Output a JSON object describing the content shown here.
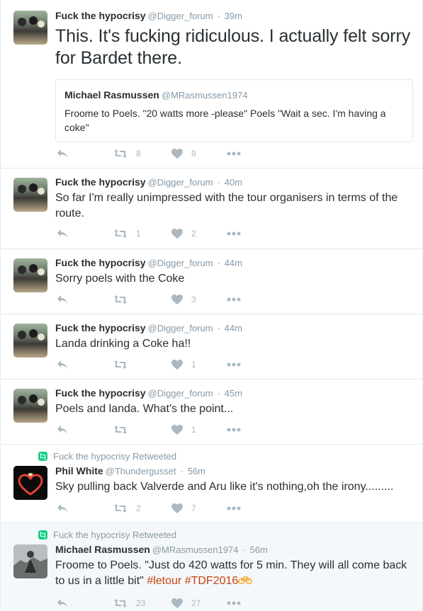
{
  "tweets": [
    {
      "id": "t1",
      "fullname": "Fuck the hypocrisy",
      "username": "@Digger_forum",
      "separator": "·",
      "time": "39m",
      "text": "This. It's fucking ridiculous. I actually felt sorry for Bardet there.",
      "quoted": {
        "fullname": "Michael Rasmussen",
        "username": "@MRasmussen1974",
        "text": "Froome to Poels. \"20 watts more -please\" Poels \"Wait a sec. I'm having a coke\""
      },
      "retweets": "8",
      "likes": "9"
    },
    {
      "id": "t2",
      "fullname": "Fuck the hypocrisy",
      "username": "@Digger_forum",
      "separator": "·",
      "time": "40m",
      "text": "So far I'm really unimpressed with the tour organisers in terms of the route.",
      "retweets": "1",
      "likes": "2"
    },
    {
      "id": "t3",
      "fullname": "Fuck the hypocrisy",
      "username": "@Digger_forum",
      "separator": "·",
      "time": "44m",
      "text": "Sorry poels with the Coke",
      "retweets": "",
      "likes": "3"
    },
    {
      "id": "t4",
      "fullname": "Fuck the hypocrisy",
      "username": "@Digger_forum",
      "separator": "·",
      "time": "44m",
      "text": "Landa drinking a Coke ha!!",
      "retweets": "",
      "likes": "1"
    },
    {
      "id": "t5",
      "fullname": "Fuck the hypocrisy",
      "username": "@Digger_forum",
      "separator": "·",
      "time": "45m",
      "text": "Poels and landa. What's the point...",
      "retweets": "",
      "likes": "1"
    },
    {
      "id": "t6",
      "context": "Fuck the hypocrisy Retweeted",
      "fullname": "Phil White",
      "username": "@Thundergusset",
      "separator": "·",
      "time": "56m",
      "text": "Sky pulling back Valverde and Aru like it's nothing,oh the irony.........",
      "retweets": "2",
      "likes": "7"
    },
    {
      "id": "t7",
      "context": "Fuck the hypocrisy Retweeted",
      "fullname": "Michael Rasmussen",
      "username": "@MRasmussen1974",
      "separator": "·",
      "time": "56m",
      "text": "Froome to Poels. \"Just do 420 watts for 5 min. They will all come back to us in a little bit\"",
      "hashtags": [
        "#letour",
        "#TDF2016"
      ],
      "retweets": "23",
      "likes": "27"
    }
  ],
  "icons": {
    "reply": "reply-icon",
    "retweet": "retweet-icon",
    "like": "heart-icon",
    "more": "more-dots-icon",
    "retweeted_context": "retweet-badge-icon",
    "bike_emoji": "bicycle-icon"
  },
  "colors": {
    "hashtag": "#c5430f",
    "muted": "#8899a6",
    "action": "#aab8c2",
    "retweet_badge": "#19cf86"
  }
}
